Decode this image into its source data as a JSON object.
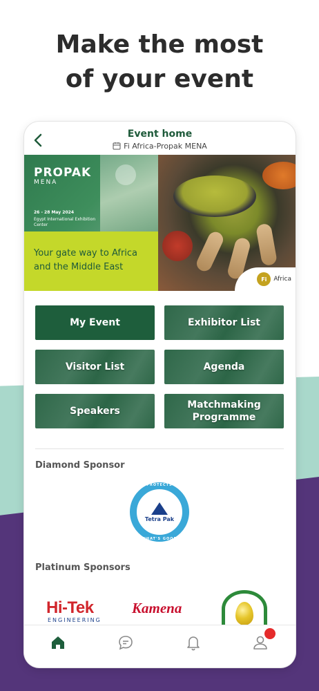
{
  "headline": {
    "line1": "Make the most",
    "line2": "of your event"
  },
  "topbar": {
    "title": "Event home",
    "event_name": "Fi Africa-Propak MENA"
  },
  "banner": {
    "logo": "PROPAK",
    "logo_sub": "MENA",
    "date": "26 - 28 May 2024",
    "venue": "Egypt International Exhibition Center",
    "tagline": "Your gate way to Africa and the Middle East",
    "fi_mark": "Fi",
    "fi_label": "Africa"
  },
  "tiles": [
    {
      "label": "My Event"
    },
    {
      "label": "Exhibitor List"
    },
    {
      "label": "Visitor List"
    },
    {
      "label": "Agenda"
    },
    {
      "label": "Speakers"
    },
    {
      "label": "Matchmaking Programme"
    }
  ],
  "sponsors": {
    "diamond_title": "Diamond Sponsor",
    "diamond": {
      "name": "Tetra Pak",
      "ring_top": "PROTECTS",
      "ring_bottom": "WHAT'S GOOD"
    },
    "platinum_title": "Platinum Sponsors",
    "platinum": [
      {
        "name": "Hi-Tek",
        "sub": "ENGINEERING"
      },
      {
        "name": "Kamena"
      },
      {
        "name": "oil-drop-logo"
      }
    ]
  },
  "nav": {
    "items": [
      "home-icon",
      "chat-icon",
      "bell-icon",
      "user-icon"
    ],
    "active": "home-icon",
    "active_color": "#1e5e3c",
    "inactive_color": "#8a8a8a",
    "badge_color": "#e52b2b"
  },
  "colors": {
    "brand_green": "#1e5e3c",
    "teal_bg": "#a9d8cb",
    "purple_bg": "#54357a",
    "lime": "#c4d82a"
  }
}
